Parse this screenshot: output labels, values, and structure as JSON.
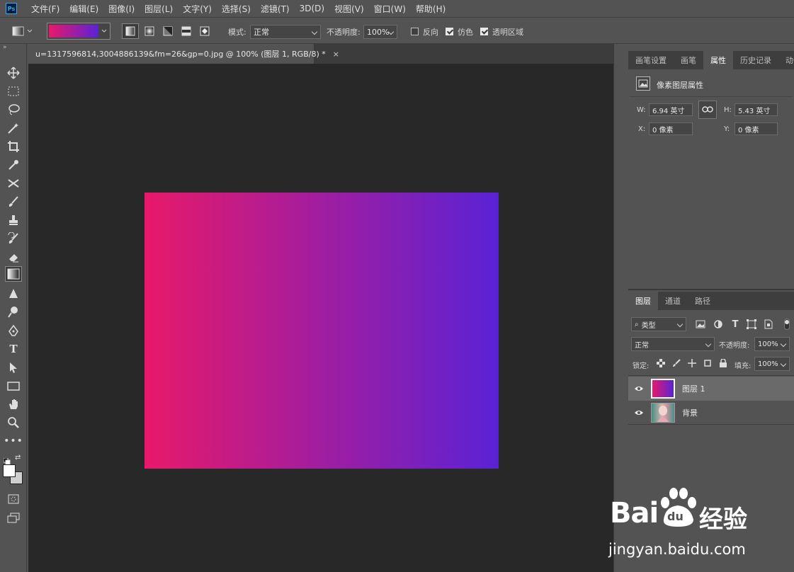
{
  "app": {
    "logo": "Ps"
  },
  "menu": [
    "文件(F)",
    "编辑(E)",
    "图像(I)",
    "图层(L)",
    "文字(Y)",
    "选择(S)",
    "滤镜(T)",
    "3D(D)",
    "视图(V)",
    "窗口(W)",
    "帮助(H)"
  ],
  "options": {
    "mode_label": "模式:",
    "mode_value": "正常",
    "opacity_label": "不透明度:",
    "opacity_value": "100%",
    "reverse_label": "反向",
    "dither_label": "仿色",
    "transparency_label": "透明区域",
    "reverse_checked": false,
    "dither_checked": true,
    "transparency_checked": true
  },
  "document": {
    "tab_title": "u=1317596814,3004886139&fm=26&gp=0.jpg @ 100% (图层 1, RGB/8) *",
    "close": "×",
    "gradient_start": "#e8196a",
    "gradient_end": "#5a22d6"
  },
  "properties": {
    "tabs": [
      "画笔设置",
      "画笔",
      "属性",
      "历史记录",
      "动作"
    ],
    "active_tab": "属性",
    "section_title": "像素图层属性",
    "w_label": "W:",
    "w_value": "6.94 英寸",
    "h_label": "H:",
    "h_value": "5.43 英寸",
    "x_label": "X:",
    "x_value": "0 像素",
    "y_label": "Y:",
    "y_value": "0 像素"
  },
  "layers_panel": {
    "tabs": [
      "图层",
      "通道",
      "路径"
    ],
    "filter_label": "类型",
    "blend_mode": "正常",
    "opacity_label": "不透明度:",
    "opacity_value": "100%",
    "lock_label": "锁定:",
    "fill_label": "填充:",
    "fill_value": "100%",
    "layers": [
      {
        "name": "图层 1",
        "selected": true
      },
      {
        "name": "背景",
        "selected": false
      }
    ]
  },
  "watermark": {
    "brand": "Bai",
    "brand2": "du",
    "brand_cn": "经验",
    "url": "jingyan.baidu.com"
  },
  "colors": {
    "panel": "#535353",
    "canvas_bg": "#282828",
    "accent": "#31a8ff"
  }
}
